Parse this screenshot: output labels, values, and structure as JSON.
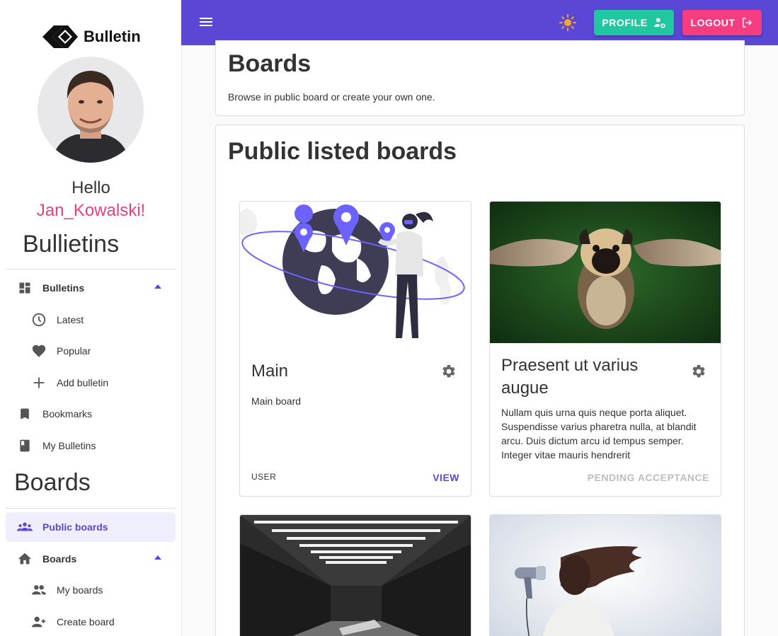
{
  "brand": {
    "name": "Bulletin"
  },
  "greeting": {
    "hello": "Hello",
    "username": "Jan_Kowalski!"
  },
  "sidebar": {
    "bulletins_title": "Bullietins",
    "boards_title": "Boards",
    "bulletins_items": [
      {
        "label": "Bulletins",
        "icon": "dashboard-icon"
      },
      {
        "label": "Latest",
        "icon": "clock-icon"
      },
      {
        "label": "Popular",
        "icon": "heart-icon"
      },
      {
        "label": "Add bulletin",
        "icon": "plus-icon"
      },
      {
        "label": "Bookmarks",
        "icon": "bookmark-icon"
      },
      {
        "label": "My Bulletins",
        "icon": "book-icon"
      }
    ],
    "boards_items": [
      {
        "label": "Public boards",
        "icon": "groups-icon"
      },
      {
        "label": "Boards",
        "icon": "home-icon"
      },
      {
        "label": "My boards",
        "icon": "people-icon"
      },
      {
        "label": "Create board",
        "icon": "person-add-icon"
      }
    ]
  },
  "topbar": {
    "profile_label": "PROFILE",
    "logout_label": "LOGOUT"
  },
  "main": {
    "title": "Boards",
    "subtitle": "Browse in public board or create your own one.",
    "public_title": "Public listed boards",
    "boards": [
      {
        "title": "Main",
        "description": "Main board",
        "role": "USER",
        "action": "VIEW"
      },
      {
        "title": "Praesent ut varius augue",
        "description": "Nullam quis urna quis neque porta aliquet. Suspendisse varius pharetra nulla, at blandit arcu. Duis dictum arcu id tempus semper. Integer vitae mauris hendrerit",
        "role": "",
        "action": "PENDING ACCEPTANCE"
      }
    ]
  },
  "colors": {
    "primary": "#5b47d6",
    "accent_pink": "#e63f7d",
    "profile_green": "#20c7a0",
    "logout_pink": "#f53d7f"
  }
}
